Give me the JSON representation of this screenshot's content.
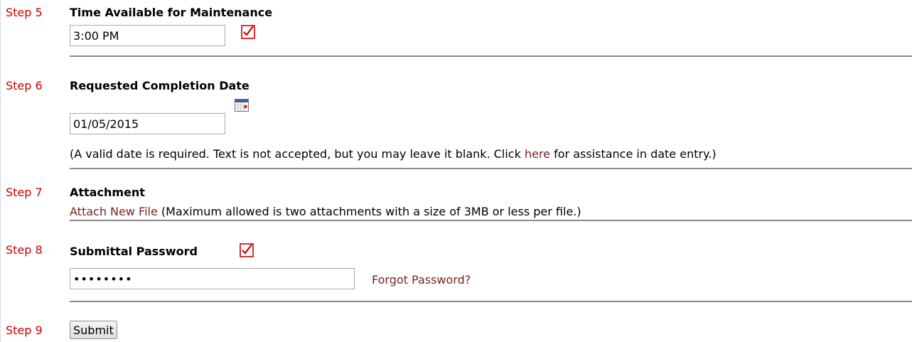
{
  "steps": [
    {
      "label": "Step 5",
      "title": "Time Available for Maintenance"
    },
    {
      "label": "Step 6",
      "title": "Requested Completion Date"
    },
    {
      "label": "Step 7",
      "title": "Attachment"
    },
    {
      "label": "Step 8",
      "title": "Submittal Password"
    },
    {
      "label": "Step 9"
    }
  ],
  "time_field": {
    "value": "3:00 PM"
  },
  "date_field": {
    "value": "01/05/2015",
    "note_before": "(A valid date is required. Text is not accepted, but you may leave it blank. Click ",
    "note_link": "here",
    "note_after": " for assistance in date entry.)"
  },
  "attachment": {
    "link": "Attach New File",
    "note": " (Maximum allowed is two attachments with a size of 3MB or less per file.)"
  },
  "password": {
    "value": "••••••••",
    "forgot_link": "Forgot Password?"
  },
  "submit_label": "Submit",
  "icons": {
    "required": "checkbox-checked-icon",
    "calendar": "calendar-icon"
  },
  "colors": {
    "step_label": "#cc0000",
    "link": "#7a1f1f",
    "checkmark": "#cc0000"
  }
}
